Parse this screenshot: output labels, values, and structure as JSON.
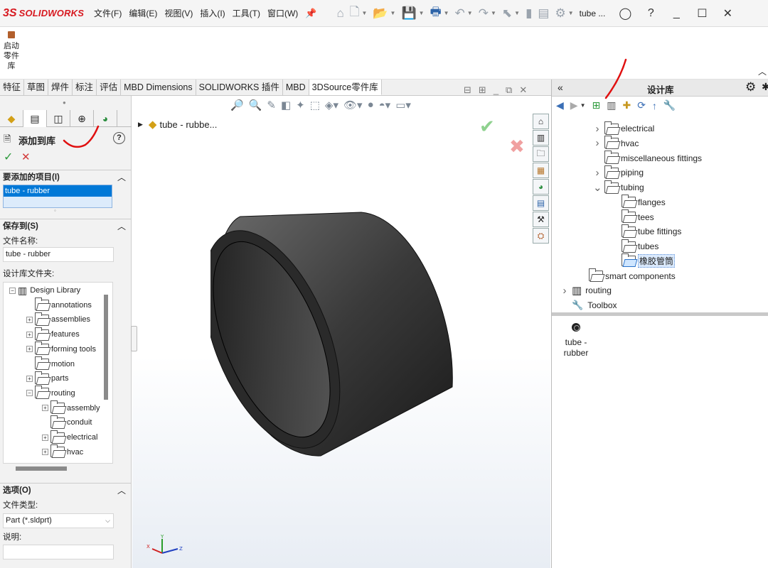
{
  "titlebar": {
    "logo_ds": "3S",
    "logo_text": "SOLIDWORKS",
    "menus": [
      "文件(F)",
      "编辑(E)",
      "视图(V)",
      "插入(I)",
      "工具(T)",
      "窗口(W)"
    ],
    "document_name": "tube ..."
  },
  "cmdbar": {
    "launch_library_label": "启动\n零件\n库"
  },
  "tabs": [
    "特征",
    "草图",
    "焊件",
    "标注",
    "评估",
    "MBD Dimensions",
    "SOLIDWORKS 插件",
    "MBD",
    "3DSource零件库"
  ],
  "active_tab": "3DSource零件库",
  "left": {
    "panel_title": "添加到库",
    "items_section": "要添加的项目(I)",
    "selected_item": "tube - rubber",
    "save_section": "保存到(S)",
    "file_name_label": "文件名称:",
    "file_name_value": "tube - rubber",
    "design_folder_label": "设计库文件夹:",
    "tree": [
      {
        "label": "Design Library",
        "level": 0,
        "expander": "-"
      },
      {
        "label": "annotations",
        "level": 1,
        "expander": ""
      },
      {
        "label": "assemblies",
        "level": 1,
        "expander": "+"
      },
      {
        "label": "features",
        "level": 1,
        "expander": "+"
      },
      {
        "label": "forming tools",
        "level": 1,
        "expander": "+"
      },
      {
        "label": "motion",
        "level": 1,
        "expander": ""
      },
      {
        "label": "parts",
        "level": 1,
        "expander": "+"
      },
      {
        "label": "routing",
        "level": 1,
        "expander": "-"
      },
      {
        "label": "assembly",
        "level": 2,
        "expander": "+"
      },
      {
        "label": "conduit",
        "level": 2,
        "expander": ""
      },
      {
        "label": "electrical",
        "level": 2,
        "expander": "+"
      },
      {
        "label": "hvac",
        "level": 2,
        "expander": "+"
      }
    ],
    "options_section": "选项(O)",
    "file_type_label": "文件类型:",
    "file_type_value": "Part (*.sldprt)",
    "description_label": "说明:",
    "description_value": ""
  },
  "viewport": {
    "breadcrumb": "tube - rubbe..."
  },
  "right": {
    "title": "设计库",
    "tree": [
      {
        "label": "electrical",
        "level": 2,
        "arrow": ">"
      },
      {
        "label": "hvac",
        "level": 2,
        "arrow": ">"
      },
      {
        "label": "miscellaneous fittings",
        "level": 2,
        "arrow": ""
      },
      {
        "label": "piping",
        "level": 2,
        "arrow": ">"
      },
      {
        "label": "tubing",
        "level": 2,
        "arrow": "v"
      },
      {
        "label": "flanges",
        "level": 3,
        "arrow": ""
      },
      {
        "label": "tees",
        "level": 3,
        "arrow": ""
      },
      {
        "label": "tube fittings",
        "level": 3,
        "arrow": ""
      },
      {
        "label": "tubes",
        "level": 3,
        "arrow": ""
      },
      {
        "label": "橡胶管筒",
        "level": 3,
        "arrow": "",
        "selected": true
      },
      {
        "label": "smart components",
        "level": 1,
        "arrow": ""
      },
      {
        "label": "routing",
        "level": 0,
        "arrow": ">",
        "icon": "library"
      },
      {
        "label": "Toolbox",
        "level": 0,
        "arrow": "",
        "icon": "toolbox"
      }
    ],
    "preview_item": "tube -\nrubber"
  },
  "colors": {
    "brand": "#d71920",
    "accent_select": "#0078d7",
    "confirm": "#2e9b3d",
    "cancel": "#d23b3b",
    "annotation": "#e01010"
  }
}
